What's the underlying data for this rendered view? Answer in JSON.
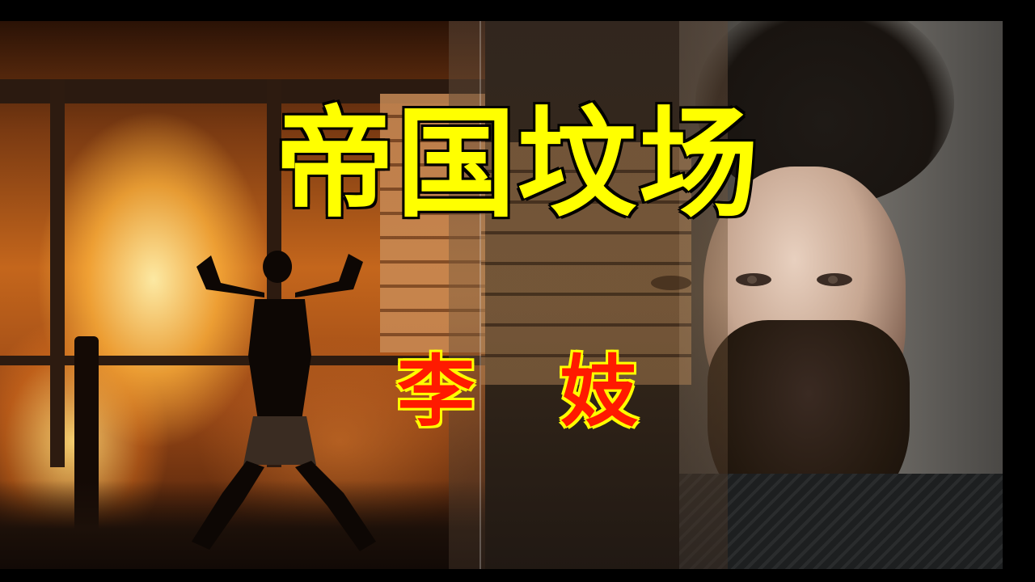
{
  "title": "帝国坟场",
  "subtitle": "李 妓",
  "colors": {
    "title": "#ffff00",
    "subtitle": "#ff1a00",
    "background": "#000000"
  }
}
